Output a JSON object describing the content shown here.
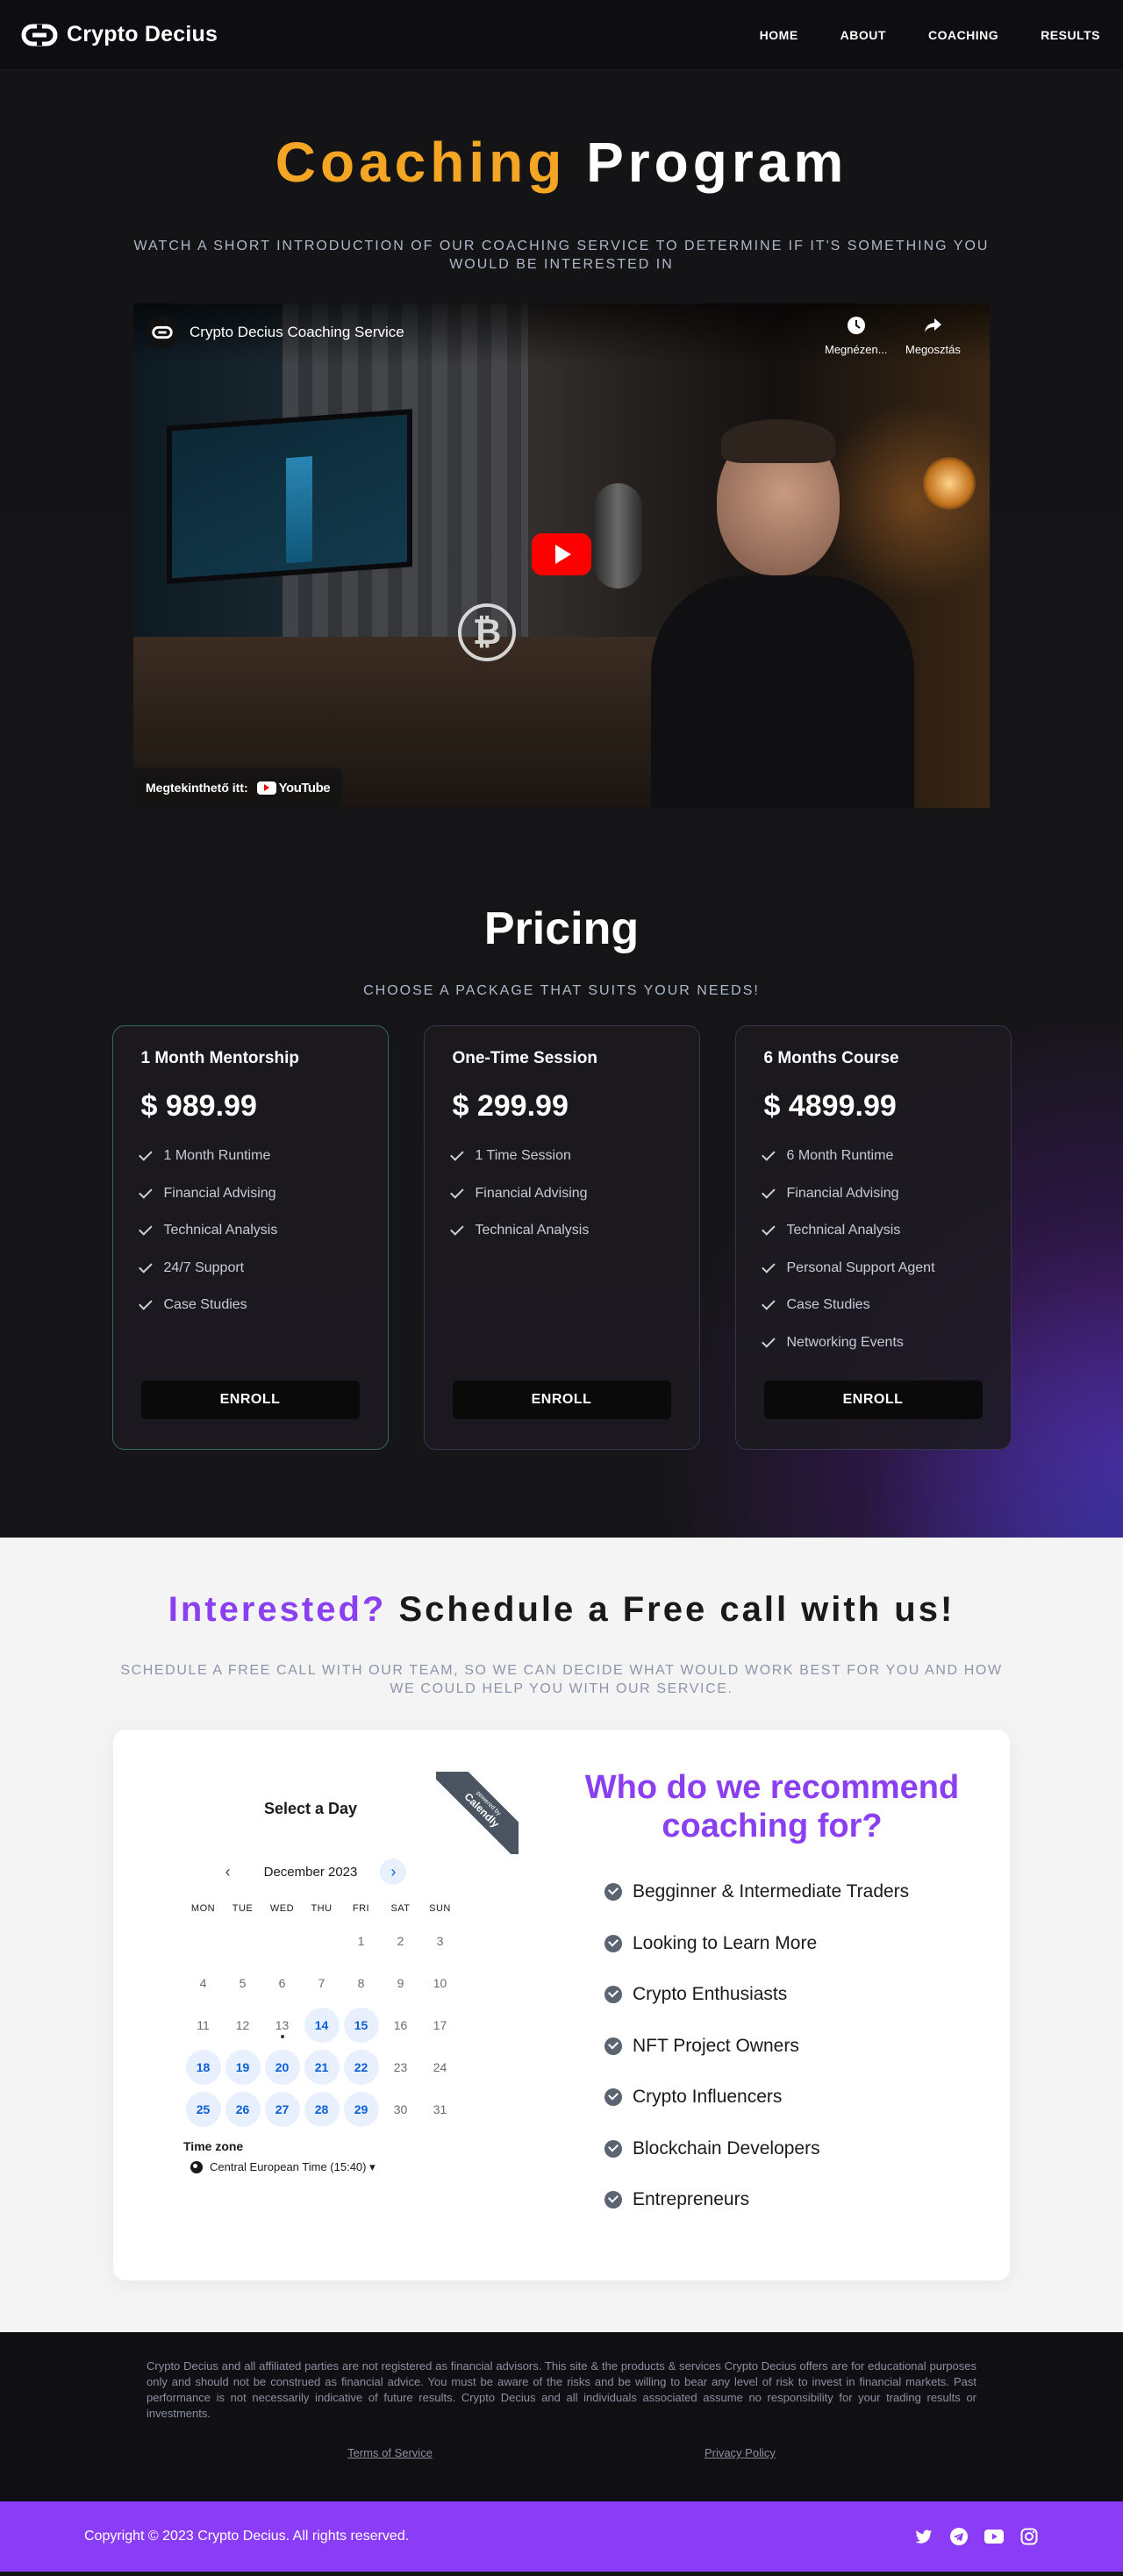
{
  "nav": {
    "brand": "Crypto Decius",
    "links": [
      "HOME",
      "ABOUT",
      "COACHING",
      "RESULTS"
    ]
  },
  "hero": {
    "title_accent": "Coaching",
    "title_rest": "Program",
    "subtitle": "WATCH A SHORT INTRODUCTION OF OUR COACHING SERVICE TO DETERMINE IF IT'S SOMETHING YOU WOULD BE INTERESTED IN"
  },
  "video": {
    "title": "Crypto Decius Coaching Service",
    "watch_later": "Megnézen...",
    "share": "Megosztás",
    "watch_on": "Megtekinthető itt:",
    "platform": "YouTube"
  },
  "pricing": {
    "title": "Pricing",
    "subtitle": "CHOOSE A PACKAGE THAT SUITS YOUR NEEDS!",
    "plans": [
      {
        "name": "1 Month Mentorship",
        "price": "$ 989.99",
        "features": [
          "1 Month Runtime",
          "Financial Advising",
          "Technical Analysis",
          "24/7 Support",
          "Case Studies"
        ],
        "cta": "ENROLL"
      },
      {
        "name": "One-Time Session",
        "price": "$ 299.99",
        "features": [
          "1 Time Session",
          "Financial Advising",
          "Technical Analysis"
        ],
        "cta": "ENROLL"
      },
      {
        "name": "6 Months Course",
        "price": "$ 4899.99",
        "features": [
          "6 Month Runtime",
          "Financial Advising",
          "Technical Analysis",
          "Personal Support Agent",
          "Case Studies",
          "Networking Events"
        ],
        "cta": "ENROLL"
      }
    ]
  },
  "schedule": {
    "title_accent": "Interested?",
    "title_rest": "Schedule a Free call with us!",
    "subtitle": "SCHEDULE A FREE CALL WITH OUR TEAM, SO WE CAN DECIDE WHAT WOULD WORK BEST FOR YOU AND HOW WE COULD HELP YOU WITH OUR SERVICE.",
    "calendar": {
      "heading": "Select a Day",
      "ribbon_small": "powered by",
      "ribbon": "Calendly",
      "month": "December 2023",
      "weekdays": [
        "MON",
        "TUE",
        "WED",
        "THU",
        "FRI",
        "SAT",
        "SUN"
      ],
      "leading_blanks": 4,
      "days": [
        "1",
        "2",
        "3",
        "4",
        "5",
        "6",
        "7",
        "8",
        "9",
        "10",
        "11",
        "12",
        "13",
        "14",
        "15",
        "16",
        "17",
        "18",
        "19",
        "20",
        "21",
        "22",
        "23",
        "24",
        "25",
        "26",
        "27",
        "28",
        "29",
        "30",
        "31"
      ],
      "available": [
        "14",
        "15",
        "18",
        "19",
        "20",
        "21",
        "22",
        "25",
        "26",
        "27",
        "28",
        "29"
      ],
      "today": "13",
      "timezone_label": "Time zone",
      "timezone": "Central European Time (15:40) ▾"
    },
    "recommend": {
      "title": "Who do we recommend coaching for?",
      "items": [
        "Begginner & Intermediate Traders",
        "Looking to Learn More",
        "Crypto Enthusiasts",
        "NFT Project Owners",
        "Crypto Influencers",
        "Blockchain Developers",
        "Entrepreneurs"
      ]
    }
  },
  "footer": {
    "disclaimer": "Crypto Decius and all affiliated parties are not registered as financial advisors. This site & the products & services Crypto Decius offers are for educational purposes only and should not be construed as financial advice. You must be aware of the risks and be willing to bear any level of risk to invest in financial markets. Past performance is not necessarily indicative of future results. Crypto Decius and all individuals associated assume no responsibility for your trading results or investments.",
    "terms": "Terms of Service",
    "privacy": "Privacy Policy",
    "copyright": "Copyright © 2023 Crypto Decius. All rights reserved.",
    "socials": [
      "twitter-icon",
      "telegram-icon",
      "youtube-icon",
      "instagram-icon"
    ]
  },
  "colors": {
    "accent_orange": "#f5a524",
    "accent_purple": "#8a3ff0",
    "footer_bar": "#8b3cf6",
    "calendar_available": "#0a5ed7"
  }
}
